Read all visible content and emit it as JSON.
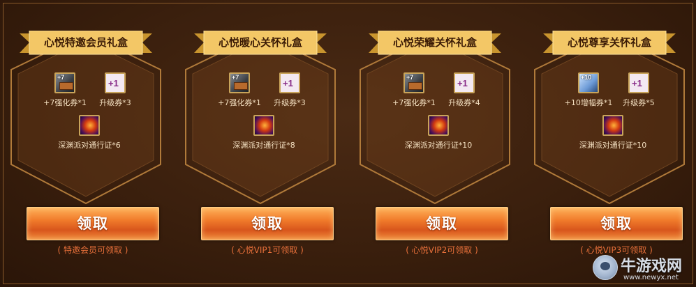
{
  "packs": [
    {
      "title": "心悦特邀会员礼盒",
      "items": [
        {
          "icon": "enhance-ticket-icon",
          "tag": "+7",
          "label": "+7强化券*1"
        },
        {
          "icon": "upgrade-ticket-icon",
          "tag": "+1",
          "label": "升级券*3"
        },
        {
          "icon": "abyss-pass-icon",
          "tag": "",
          "label": "深渊派对通行证*6"
        }
      ],
      "button": "领取",
      "note": "( 特邀会员可领取 )"
    },
    {
      "title": "心悦暖心关怀礼盒",
      "items": [
        {
          "icon": "enhance-ticket-icon",
          "tag": "+7",
          "label": "+7强化券*1"
        },
        {
          "icon": "upgrade-ticket-icon",
          "tag": "+1",
          "label": "升级券*3"
        },
        {
          "icon": "abyss-pass-icon",
          "tag": "",
          "label": "深渊派对通行证*8"
        }
      ],
      "button": "领取",
      "note": "( 心悦VIP1可领取 )"
    },
    {
      "title": "心悦荣耀关怀礼盒",
      "items": [
        {
          "icon": "enhance-ticket-icon",
          "tag": "+7",
          "label": "+7强化券*1"
        },
        {
          "icon": "upgrade-ticket-icon",
          "tag": "+1",
          "label": "升级券*4"
        },
        {
          "icon": "abyss-pass-icon",
          "tag": "",
          "label": "深渊派对通行证*10"
        }
      ],
      "button": "领取",
      "note": "( 心悦VIP2可领取 )"
    },
    {
      "title": "心悦尊享关怀礼盒",
      "items": [
        {
          "icon": "amplify-ticket-icon",
          "tag": "+10",
          "label": "+10增幅券*1"
        },
        {
          "icon": "upgrade-ticket-icon",
          "tag": "+1",
          "label": "升级券*5"
        },
        {
          "icon": "abyss-pass-icon",
          "tag": "",
          "label": "深渊派对通行证*10"
        }
      ],
      "button": "领取",
      "note": "( 心悦VIP3可领取 )"
    }
  ],
  "watermark": {
    "title": "牛游戏网",
    "url": "www.newyx.net"
  },
  "colors": {
    "background": "#3a1f0d",
    "ribbon": "#f3c766",
    "button": "#f07a2a",
    "note": "#e8703a",
    "label": "#f3dfc0"
  }
}
